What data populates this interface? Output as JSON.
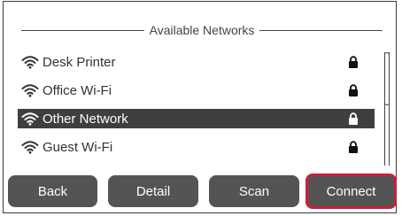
{
  "header": {
    "title": "Available Networks"
  },
  "networks": [
    {
      "name": "Desk Printer",
      "secured": true,
      "selected": false,
      "icon": "wifi-icon"
    },
    {
      "name": "Office Wi-Fi",
      "secured": true,
      "selected": false,
      "icon": "wifi-icon"
    },
    {
      "name": "Other Network",
      "secured": true,
      "selected": true,
      "icon": "wifi-icon"
    },
    {
      "name": "Guest Wi-Fi",
      "secured": true,
      "selected": false,
      "icon": "wifi-icon"
    }
  ],
  "buttons": {
    "back": "Back",
    "detail": "Detail",
    "scan": "Scan",
    "connect": "Connect"
  },
  "colors": {
    "selection_bg": "#3f3f3f",
    "button_bg": "#545454",
    "focus_border": "#c8203a"
  }
}
